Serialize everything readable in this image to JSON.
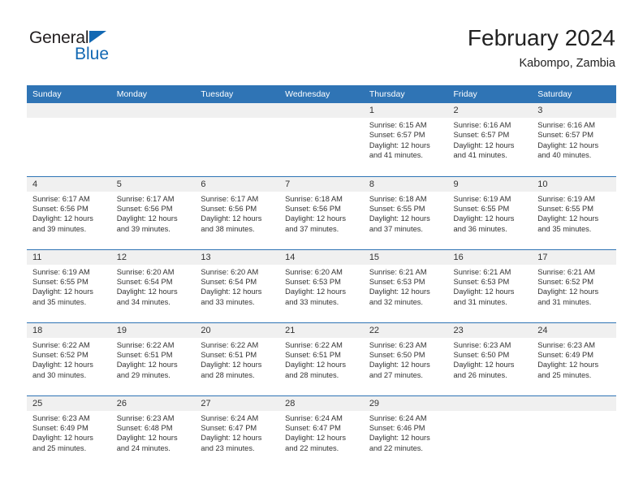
{
  "brand": {
    "name_top": "General",
    "name_bottom": "Blue",
    "triangle_color": "#1268b3",
    "text_color": "#231f20"
  },
  "header": {
    "title": "February 2024",
    "subtitle": "Kabompo, Zambia"
  },
  "theme": {
    "header_blue": "#2f74b5",
    "daynum_band": "#f0f0f0",
    "text": "#333333"
  },
  "calendar": {
    "weekday_headers": [
      "Sunday",
      "Monday",
      "Tuesday",
      "Wednesday",
      "Thursday",
      "Friday",
      "Saturday"
    ],
    "weeks": [
      [
        {
          "day": "",
          "sunrise": "",
          "sunset": "",
          "daylight1": "",
          "daylight2": ""
        },
        {
          "day": "",
          "sunrise": "",
          "sunset": "",
          "daylight1": "",
          "daylight2": ""
        },
        {
          "day": "",
          "sunrise": "",
          "sunset": "",
          "daylight1": "",
          "daylight2": ""
        },
        {
          "day": "",
          "sunrise": "",
          "sunset": "",
          "daylight1": "",
          "daylight2": ""
        },
        {
          "day": "1",
          "sunrise": "Sunrise: 6:15 AM",
          "sunset": "Sunset: 6:57 PM",
          "daylight1": "Daylight: 12 hours",
          "daylight2": "and 41 minutes."
        },
        {
          "day": "2",
          "sunrise": "Sunrise: 6:16 AM",
          "sunset": "Sunset: 6:57 PM",
          "daylight1": "Daylight: 12 hours",
          "daylight2": "and 41 minutes."
        },
        {
          "day": "3",
          "sunrise": "Sunrise: 6:16 AM",
          "sunset": "Sunset: 6:57 PM",
          "daylight1": "Daylight: 12 hours",
          "daylight2": "and 40 minutes."
        }
      ],
      [
        {
          "day": "4",
          "sunrise": "Sunrise: 6:17 AM",
          "sunset": "Sunset: 6:56 PM",
          "daylight1": "Daylight: 12 hours",
          "daylight2": "and 39 minutes."
        },
        {
          "day": "5",
          "sunrise": "Sunrise: 6:17 AM",
          "sunset": "Sunset: 6:56 PM",
          "daylight1": "Daylight: 12 hours",
          "daylight2": "and 39 minutes."
        },
        {
          "day": "6",
          "sunrise": "Sunrise: 6:17 AM",
          "sunset": "Sunset: 6:56 PM",
          "daylight1": "Daylight: 12 hours",
          "daylight2": "and 38 minutes."
        },
        {
          "day": "7",
          "sunrise": "Sunrise: 6:18 AM",
          "sunset": "Sunset: 6:56 PM",
          "daylight1": "Daylight: 12 hours",
          "daylight2": "and 37 minutes."
        },
        {
          "day": "8",
          "sunrise": "Sunrise: 6:18 AM",
          "sunset": "Sunset: 6:55 PM",
          "daylight1": "Daylight: 12 hours",
          "daylight2": "and 37 minutes."
        },
        {
          "day": "9",
          "sunrise": "Sunrise: 6:19 AM",
          "sunset": "Sunset: 6:55 PM",
          "daylight1": "Daylight: 12 hours",
          "daylight2": "and 36 minutes."
        },
        {
          "day": "10",
          "sunrise": "Sunrise: 6:19 AM",
          "sunset": "Sunset: 6:55 PM",
          "daylight1": "Daylight: 12 hours",
          "daylight2": "and 35 minutes."
        }
      ],
      [
        {
          "day": "11",
          "sunrise": "Sunrise: 6:19 AM",
          "sunset": "Sunset: 6:55 PM",
          "daylight1": "Daylight: 12 hours",
          "daylight2": "and 35 minutes."
        },
        {
          "day": "12",
          "sunrise": "Sunrise: 6:20 AM",
          "sunset": "Sunset: 6:54 PM",
          "daylight1": "Daylight: 12 hours",
          "daylight2": "and 34 minutes."
        },
        {
          "day": "13",
          "sunrise": "Sunrise: 6:20 AM",
          "sunset": "Sunset: 6:54 PM",
          "daylight1": "Daylight: 12 hours",
          "daylight2": "and 33 minutes."
        },
        {
          "day": "14",
          "sunrise": "Sunrise: 6:20 AM",
          "sunset": "Sunset: 6:53 PM",
          "daylight1": "Daylight: 12 hours",
          "daylight2": "and 33 minutes."
        },
        {
          "day": "15",
          "sunrise": "Sunrise: 6:21 AM",
          "sunset": "Sunset: 6:53 PM",
          "daylight1": "Daylight: 12 hours",
          "daylight2": "and 32 minutes."
        },
        {
          "day": "16",
          "sunrise": "Sunrise: 6:21 AM",
          "sunset": "Sunset: 6:53 PM",
          "daylight1": "Daylight: 12 hours",
          "daylight2": "and 31 minutes."
        },
        {
          "day": "17",
          "sunrise": "Sunrise: 6:21 AM",
          "sunset": "Sunset: 6:52 PM",
          "daylight1": "Daylight: 12 hours",
          "daylight2": "and 31 minutes."
        }
      ],
      [
        {
          "day": "18",
          "sunrise": "Sunrise: 6:22 AM",
          "sunset": "Sunset: 6:52 PM",
          "daylight1": "Daylight: 12 hours",
          "daylight2": "and 30 minutes."
        },
        {
          "day": "19",
          "sunrise": "Sunrise: 6:22 AM",
          "sunset": "Sunset: 6:51 PM",
          "daylight1": "Daylight: 12 hours",
          "daylight2": "and 29 minutes."
        },
        {
          "day": "20",
          "sunrise": "Sunrise: 6:22 AM",
          "sunset": "Sunset: 6:51 PM",
          "daylight1": "Daylight: 12 hours",
          "daylight2": "and 28 minutes."
        },
        {
          "day": "21",
          "sunrise": "Sunrise: 6:22 AM",
          "sunset": "Sunset: 6:51 PM",
          "daylight1": "Daylight: 12 hours",
          "daylight2": "and 28 minutes."
        },
        {
          "day": "22",
          "sunrise": "Sunrise: 6:23 AM",
          "sunset": "Sunset: 6:50 PM",
          "daylight1": "Daylight: 12 hours",
          "daylight2": "and 27 minutes."
        },
        {
          "day": "23",
          "sunrise": "Sunrise: 6:23 AM",
          "sunset": "Sunset: 6:50 PM",
          "daylight1": "Daylight: 12 hours",
          "daylight2": "and 26 minutes."
        },
        {
          "day": "24",
          "sunrise": "Sunrise: 6:23 AM",
          "sunset": "Sunset: 6:49 PM",
          "daylight1": "Daylight: 12 hours",
          "daylight2": "and 25 minutes."
        }
      ],
      [
        {
          "day": "25",
          "sunrise": "Sunrise: 6:23 AM",
          "sunset": "Sunset: 6:49 PM",
          "daylight1": "Daylight: 12 hours",
          "daylight2": "and 25 minutes."
        },
        {
          "day": "26",
          "sunrise": "Sunrise: 6:23 AM",
          "sunset": "Sunset: 6:48 PM",
          "daylight1": "Daylight: 12 hours",
          "daylight2": "and 24 minutes."
        },
        {
          "day": "27",
          "sunrise": "Sunrise: 6:24 AM",
          "sunset": "Sunset: 6:47 PM",
          "daylight1": "Daylight: 12 hours",
          "daylight2": "and 23 minutes."
        },
        {
          "day": "28",
          "sunrise": "Sunrise: 6:24 AM",
          "sunset": "Sunset: 6:47 PM",
          "daylight1": "Daylight: 12 hours",
          "daylight2": "and 22 minutes."
        },
        {
          "day": "29",
          "sunrise": "Sunrise: 6:24 AM",
          "sunset": "Sunset: 6:46 PM",
          "daylight1": "Daylight: 12 hours",
          "daylight2": "and 22 minutes."
        },
        {
          "day": "",
          "sunrise": "",
          "sunset": "",
          "daylight1": "",
          "daylight2": ""
        },
        {
          "day": "",
          "sunrise": "",
          "sunset": "",
          "daylight1": "",
          "daylight2": ""
        }
      ]
    ]
  }
}
